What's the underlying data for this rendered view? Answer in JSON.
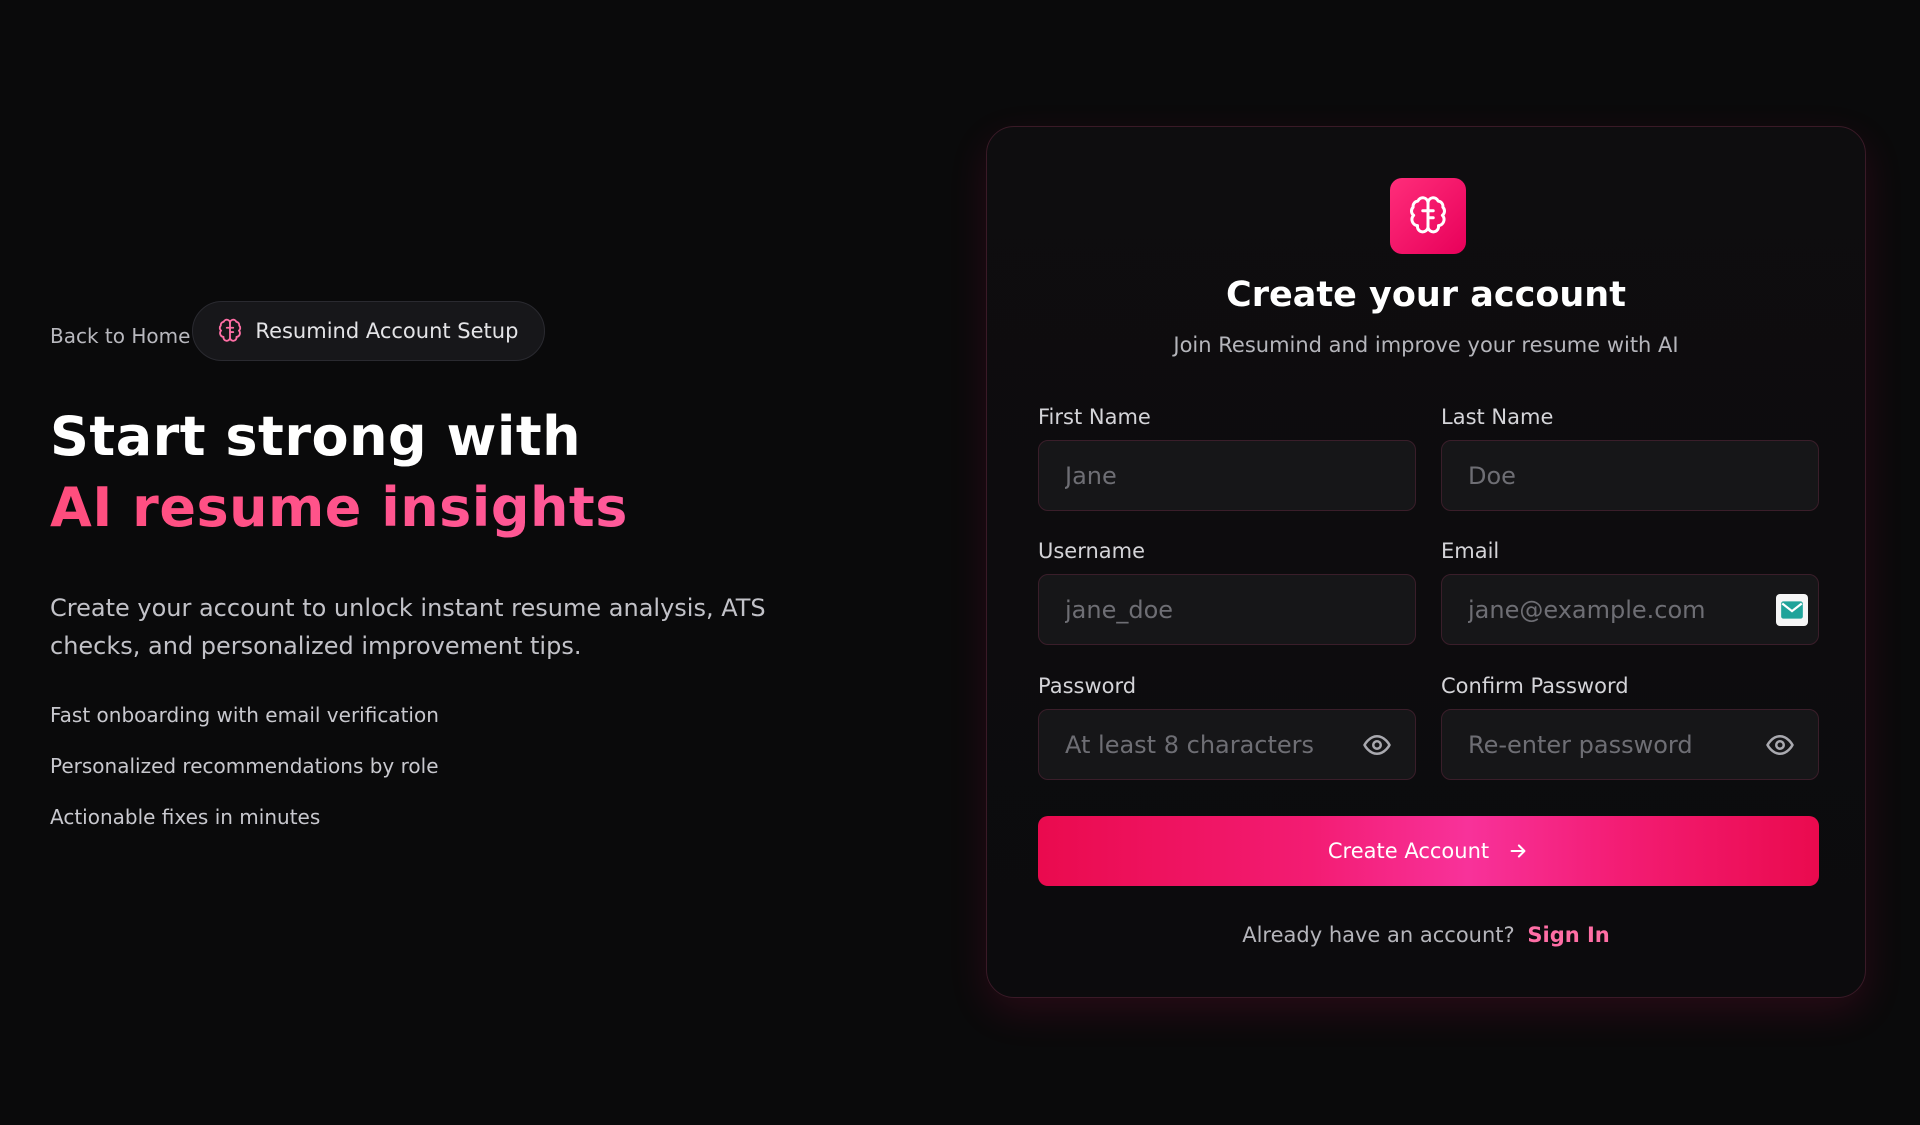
{
  "hero": {
    "back_link": "Back to Home",
    "badge_label": "Resumind Account Setup",
    "headline_line1": "Start strong with",
    "headline_line2": "AI resume insights",
    "description": "Create your account to unlock instant resume analysis, ATS checks, and personalized improvement tips.",
    "features": [
      "Fast onboarding with email verification",
      "Personalized recommendations by role",
      "Actionable fixes in minutes"
    ]
  },
  "card": {
    "logo_icon": "brain-icon",
    "title": "Create your account",
    "subtitle": "Join Resumind and improve your resume with AI",
    "fields": {
      "first_name": {
        "label": "First Name",
        "placeholder": "Jane",
        "value": ""
      },
      "last_name": {
        "label": "Last Name",
        "placeholder": "Doe",
        "value": ""
      },
      "username": {
        "label": "Username",
        "placeholder": "jane_doe",
        "value": ""
      },
      "email": {
        "label": "Email",
        "placeholder": "jane@example.com",
        "value": ""
      },
      "password": {
        "label": "Password",
        "placeholder": "At least 8 characters",
        "value": ""
      },
      "confirm_password": {
        "label": "Confirm Password",
        "placeholder": "Re-enter password",
        "value": ""
      }
    },
    "submit_label": "Create Account",
    "signin_prompt": "Already have an account?",
    "signin_link": "Sign In"
  },
  "colors": {
    "background": "#0a0a0b",
    "accent": "#f31c73",
    "accent_text": "#ff6ea5",
    "headline_gradient_start": "#ff4d7d",
    "headline_gradient_end": "#ff5fa6"
  }
}
